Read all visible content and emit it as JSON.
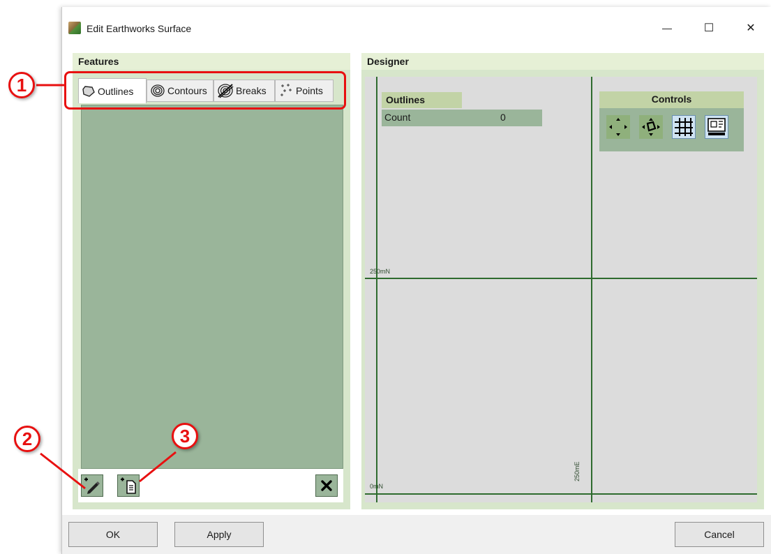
{
  "window": {
    "title": "Edit Earthworks Surface",
    "minimize_glyph": "—",
    "maximize_glyph": "☐",
    "close_glyph": "✕"
  },
  "features": {
    "header": "Features",
    "tabs": [
      {
        "label": "Outlines",
        "icon": "outline-polygon-icon",
        "active": true
      },
      {
        "label": "Contours",
        "icon": "contours-icon",
        "active": false
      },
      {
        "label": "Breaks",
        "icon": "breaks-icon",
        "active": false
      },
      {
        "label": "Points",
        "icon": "points-icon",
        "active": false
      }
    ],
    "toolbar": {
      "add_draw_icon": "add-draw-pencil-icon",
      "add_import_icon": "add-import-document-icon",
      "delete_icon": "delete-x-icon"
    }
  },
  "designer": {
    "header": "Designer",
    "outlines_box": {
      "title": "Outlines",
      "count_label": "Count",
      "count_value": "0"
    },
    "controls": {
      "title": "Controls",
      "buttons": [
        "pan-icon",
        "rotate-icon",
        "grid-icon",
        "layout-icon"
      ]
    },
    "axis_labels": {
      "north_250": "250mN",
      "north_0": "0mN",
      "east_250": "250mE"
    }
  },
  "buttons": {
    "ok": "OK",
    "apply": "Apply",
    "cancel": "Cancel"
  },
  "callouts": [
    "1",
    "2",
    "3"
  ],
  "colors": {
    "panel_header": "#e6f0d6",
    "panel_body": "#d7e6cb",
    "list_green": "#9ab59a",
    "grid_line": "#2e6b2e",
    "callout_red": "#e81010"
  }
}
